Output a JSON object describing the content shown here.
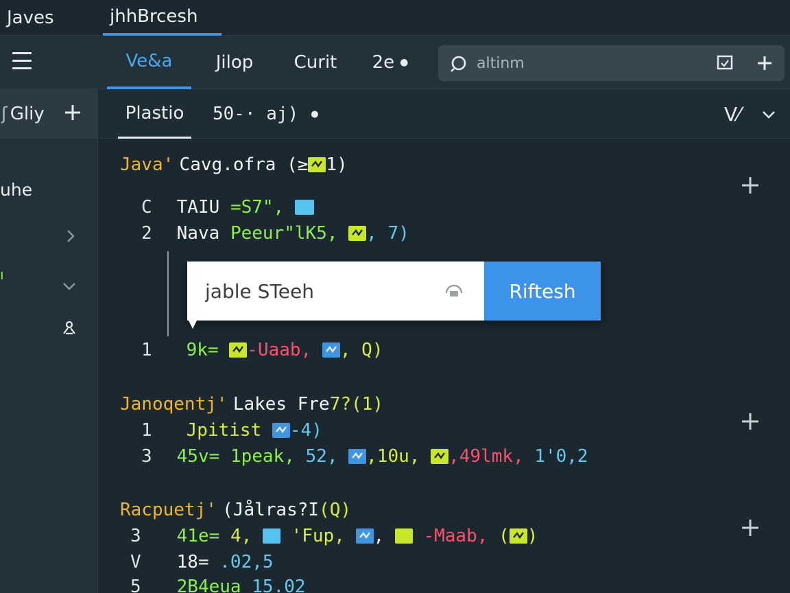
{
  "window_tabs": [
    "Javes",
    "jhhBrcesh"
  ],
  "toolbar": {
    "tabs": [
      "Ve&a",
      "Jilop",
      "Curit",
      "2e"
    ],
    "search_placeholder": "altinm"
  },
  "left_panel": {
    "header": "Gliy",
    "items": [
      "uhe",
      "ı"
    ]
  },
  "editor": {
    "subtabs": [
      "Plastio",
      "50-· aj)"
    ],
    "right_label": "V⁄",
    "sections": [
      {
        "head_kw": "Java'",
        "head_text": "Cavg.ofra (≥",
        "head_end": "1)",
        "lines": [
          {
            "num": "C",
            "a": "TAIU",
            "b": "=S7\","
          },
          {
            "num": "2",
            "a": "Nava",
            "b": "Peeur\"lK5,",
            "c": ", 7)"
          }
        ]
      },
      {
        "line": {
          "num": "1",
          "a": "9k=",
          "b": "-Uaab,",
          "c": ", Q)"
        }
      },
      {
        "head_kw": "Janoqentj'",
        "head_text": "Lakes Fre",
        "head_end": "7?(1)",
        "lines": [
          {
            "num": "1",
            "a": "Jpitist",
            "b": "-4)"
          },
          {
            "num": "3",
            "a": "45v=",
            "b": "1peak,",
            "c": "52,",
            "d": ",10u,",
            "e": ",49lmk,",
            "f": "1'0,2"
          }
        ]
      },
      {
        "head_kw": "Racpuetj'",
        "head_text": "(Jålras?I",
        "head_end": "(Q)",
        "lines": [
          {
            "num": "3",
            "a": "41e=",
            "b": "4,",
            "c": "'Fup,",
            "d": ",",
            "e": "-Maab,",
            "f": "(",
            "g": ")"
          },
          {
            "num": "V",
            "a": "18=",
            "b": ".02,5"
          },
          {
            "num": "5",
            "a": "2B4eua",
            "b": "15.02"
          }
        ]
      }
    ]
  },
  "popup": {
    "input_value": "jable STeeh",
    "button_label": "Riftesh"
  },
  "colors": {
    "accent": "#3a97e8",
    "keyword": "#f0b429",
    "string_green": "#8df04a",
    "cyan": "#66c8f0",
    "red": "#ff4f6a"
  }
}
